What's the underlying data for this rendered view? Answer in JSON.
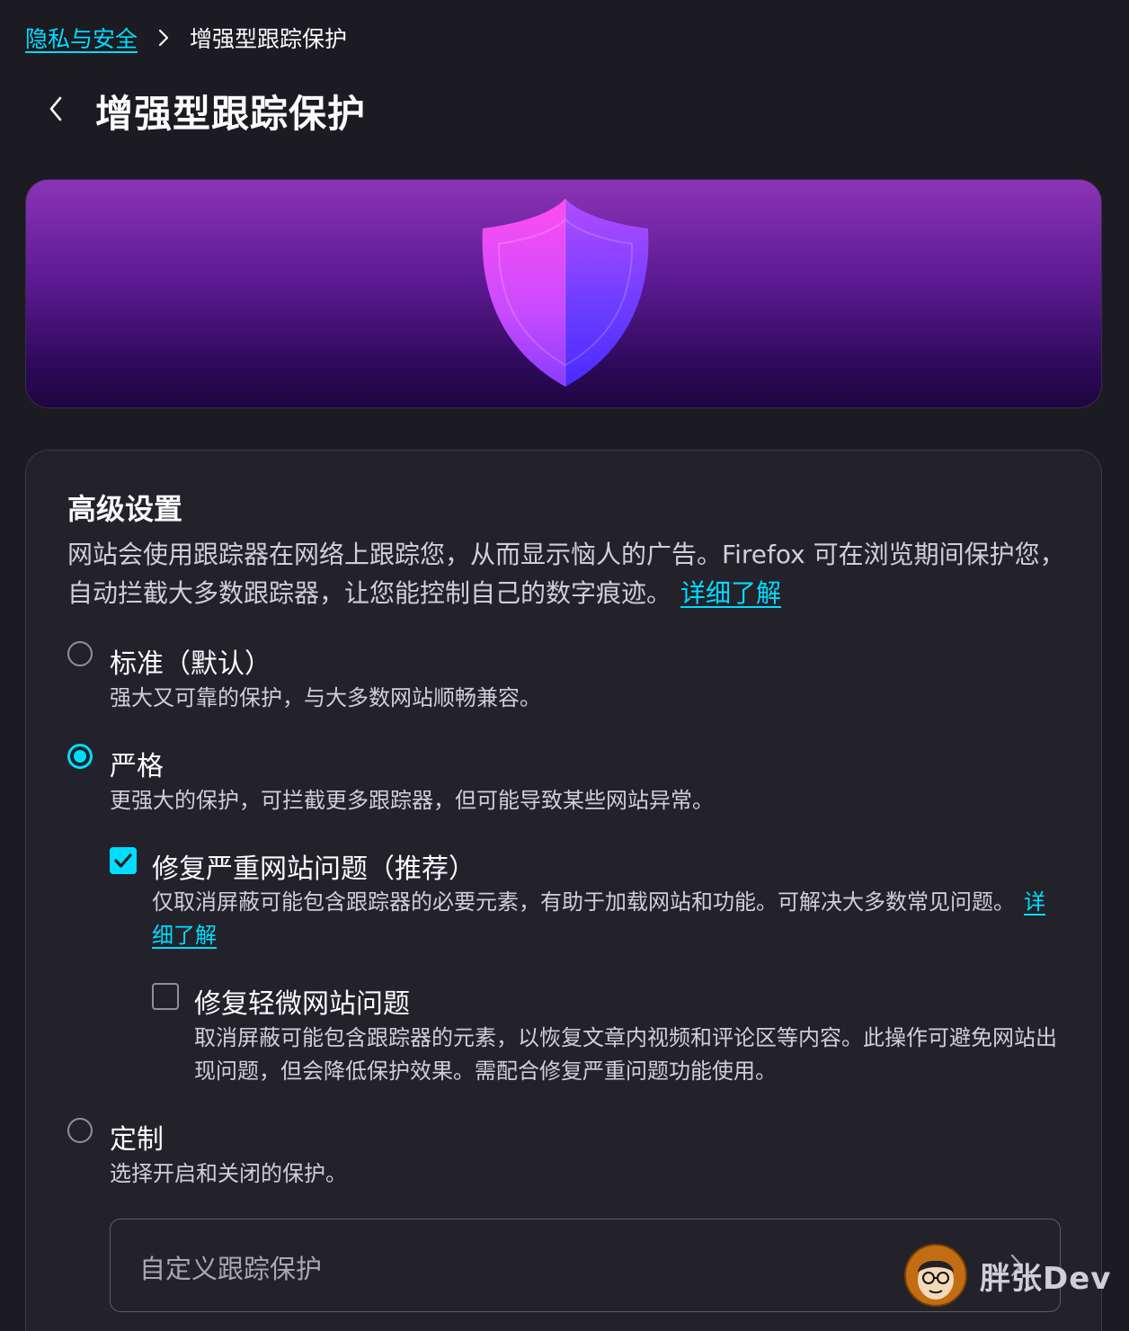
{
  "breadcrumb": {
    "parent": "隐私与安全",
    "current": "增强型跟踪保护"
  },
  "header": {
    "title": "增强型跟踪保护"
  },
  "settings": {
    "title": "高级设置",
    "description": "网站会使用跟踪器在网络上跟踪您，从而显示恼人的广告。Firefox 可在浏览期间保护您，自动拦截大多数跟踪器，让您能控制自己的数字痕迹。",
    "learn_more": "详细了解",
    "options": [
      {
        "label": "标准（默认）",
        "description": "强大又可靠的保护，与大多数网站顺畅兼容。",
        "selected": false
      },
      {
        "label": "严格",
        "description": "更强大的保护，可拦截更多跟踪器，但可能导致某些网站异常。",
        "selected": true
      },
      {
        "label": "定制",
        "description": "选择开启和关闭的保护。",
        "selected": false
      }
    ],
    "fix_major": {
      "label": "修复严重网站问题（推荐）",
      "description": "仅取消屏蔽可能包含跟踪器的必要元素，有助于加载网站和功能。可解决大多数常见问题。",
      "learn_more": "详细了解",
      "checked": true
    },
    "fix_minor": {
      "label": "修复轻微网站问题",
      "description": "取消屏蔽可能包含跟踪器的元素，以恢复文章内视频和评论区等内容。此操作可避免网站出现问题，但会降低保护效果。需配合修复严重问题功能使用。",
      "checked": false
    },
    "custom_row": {
      "label": "自定义跟踪保护"
    }
  },
  "watermark": {
    "text": "胖张Dev"
  },
  "colors": {
    "accent": "#00ddff",
    "background": "#1c1b22",
    "card": "#23222b",
    "banner_top": "#8a34b6",
    "banner_bottom": "#1e0640"
  },
  "icons": [
    "chevron-right-icon",
    "chevron-left-icon",
    "shield-icon",
    "checkmark-icon",
    "chevron-right-icon"
  ]
}
